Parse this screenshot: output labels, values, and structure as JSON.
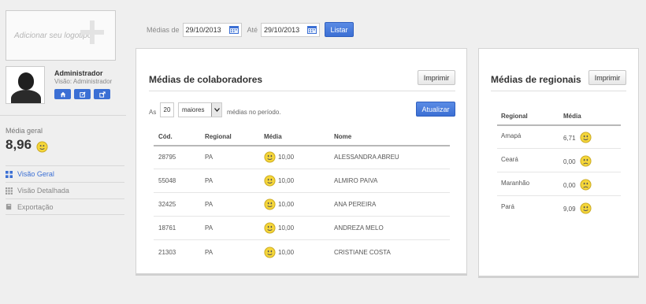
{
  "sidebar": {
    "logo_text": "Adicionar seu logotipo",
    "user_name": "Administrador",
    "user_role": "Visão: Administrador",
    "user_buttons": [
      "home-icon",
      "edit-icon",
      "share-icon"
    ],
    "media_geral_label": "Média geral",
    "media_geral_value": "8,96",
    "nav": [
      {
        "label": "Visão Geral",
        "icon": "grid-icon",
        "active": true
      },
      {
        "label": "Visão Detalhada",
        "icon": "grid-detail-icon",
        "active": false
      },
      {
        "label": "Exportação",
        "icon": "book-icon",
        "active": false
      }
    ]
  },
  "filter": {
    "from_label": "Médias de",
    "from_value": "29/10/2013",
    "to_label": "Até",
    "to_value": "29/10/2013",
    "list_button": "Listar"
  },
  "colab": {
    "title": "Médias de colaboradores",
    "print_button": "Imprimir",
    "as_label": "As",
    "count": "20",
    "order_option": "maiores",
    "period_text": "médias no período.",
    "update_button": "Atualizar",
    "headers": [
      "Cód.",
      "Regional",
      "Média",
      "Nome"
    ],
    "rows": [
      {
        "cod": "28795",
        "regional": "PA",
        "media": "10,00",
        "nome": "ALESSANDRA ABREU"
      },
      {
        "cod": "55048",
        "regional": "PA",
        "media": "10,00",
        "nome": "ALMIRO PAIVA"
      },
      {
        "cod": "32425",
        "regional": "PA",
        "media": "10,00",
        "nome": "ANA PEREIRA"
      },
      {
        "cod": "18761",
        "regional": "PA",
        "media": "10,00",
        "nome": "ANDREZA MELO"
      },
      {
        "cod": "21303",
        "regional": "PA",
        "media": "10,00",
        "nome": "CRISTIANE COSTA"
      }
    ]
  },
  "regionais": {
    "title": "Médias de regionais",
    "print_button": "Imprimir",
    "headers": [
      "Regional",
      "Média"
    ],
    "rows": [
      {
        "regional": "Amapá",
        "media": "6,71",
        "mood": "happy"
      },
      {
        "regional": "Ceará",
        "media": "0,00",
        "mood": "sad"
      },
      {
        "regional": "Maranhão",
        "media": "0,00",
        "mood": "sad"
      },
      {
        "regional": "Pará",
        "media": "9,09",
        "mood": "happy"
      }
    ]
  },
  "colors": {
    "accent": "#3b6fd4",
    "smiley": "#f5d63a"
  }
}
